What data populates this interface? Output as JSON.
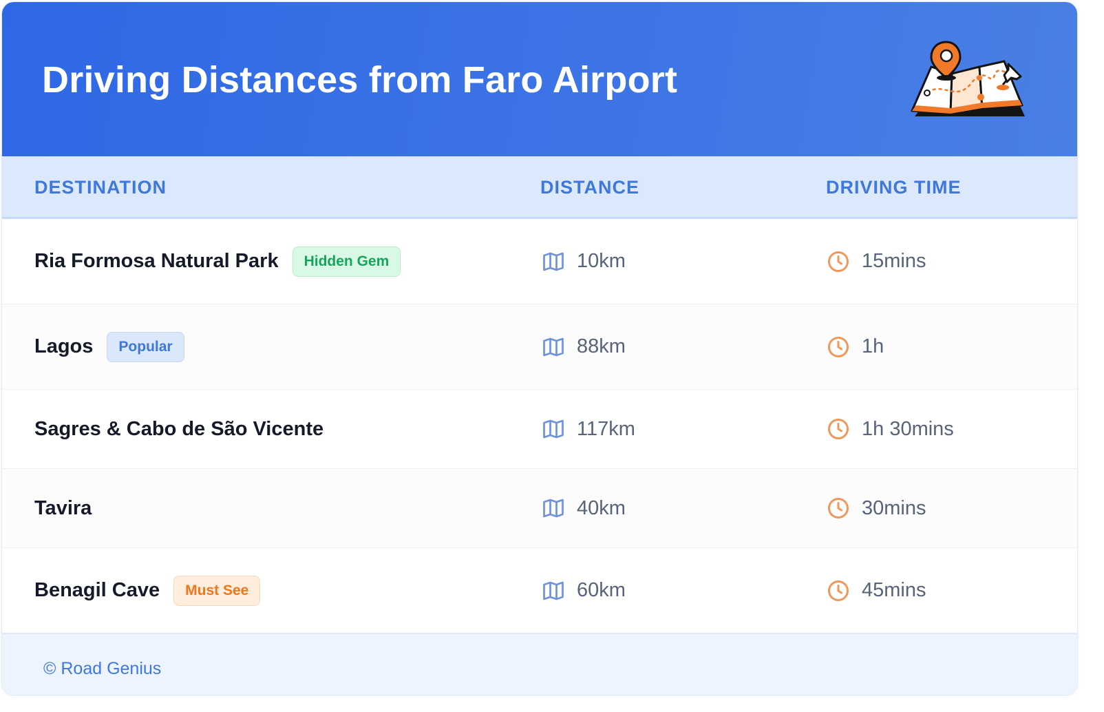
{
  "header": {
    "title": "Driving Distances from Faro Airport",
    "illustration_icon": "map-with-pin-icon"
  },
  "table": {
    "columns": [
      "DESTINATION",
      "DISTANCE",
      "DRIVING TIME"
    ],
    "distance_icon": "map-icon",
    "time_icon": "clock-icon",
    "rows": [
      {
        "destination": "Ria Formosa Natural Park",
        "badge": "Hidden Gem",
        "badge_color": "#17a45b",
        "distance": "10km",
        "time": "15mins"
      },
      {
        "destination": "Lagos",
        "badge": "Popular",
        "badge_color": "#3f77d6",
        "distance": "88km",
        "time": "1h"
      },
      {
        "destination": "Sagres & Cabo de São Vicente",
        "badge": "",
        "badge_color": "",
        "distance": "117km",
        "time": "1h 30mins"
      },
      {
        "destination": "Tavira",
        "badge": "",
        "badge_color": "",
        "distance": "40km",
        "time": "30mins"
      },
      {
        "destination": "Benagil Cave",
        "badge": "Must See",
        "badge_color": "#f0761a",
        "distance": "60km",
        "time": "45mins"
      }
    ]
  },
  "footer": {
    "text": "© Road Genius"
  },
  "colors": {
    "header_gradient_start": "#2f68e6",
    "header_gradient_end": "#4a80e4",
    "accent_blue": "#3f78dc",
    "clock_orange": "#f0975a"
  }
}
